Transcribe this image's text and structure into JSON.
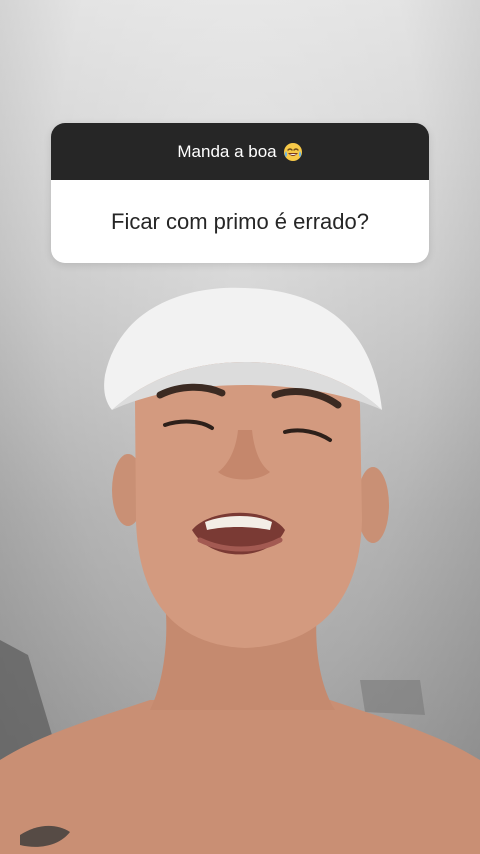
{
  "question_sticker": {
    "prompt": "Manda a boa",
    "prompt_emoji": "face-with-tears-of-joy-icon",
    "answer": "Ficar com primo é errado?"
  },
  "colors": {
    "sticker_header_bg": "#262626",
    "sticker_body_bg": "#ffffff",
    "sticker_answer_text": "#262626",
    "sticker_header_text": "#ffffff"
  }
}
